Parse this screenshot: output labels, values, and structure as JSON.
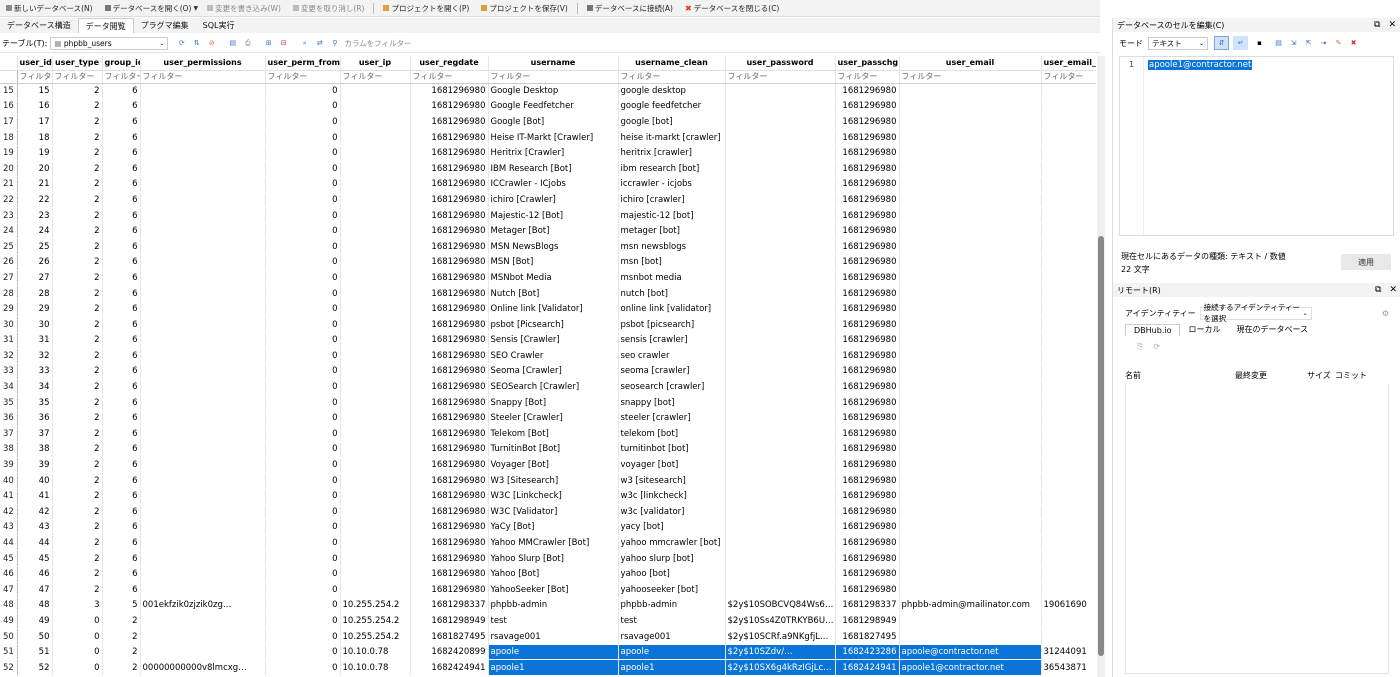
{
  "toolbar": {
    "new_db": "新しいデータベース(N)",
    "open_db": "データベースを開く(O)",
    "write_changes": "変更を書き込み(W)",
    "revert_changes": "変更を取り消し(R)",
    "open_project": "プロジェクトを開く(P)",
    "save_project": "プロジェクトを保存(V)",
    "attach_db": "データベースに接続(A)",
    "close_db": "データベースを閉じる(C)"
  },
  "tabs": [
    "データベース構造",
    "データ閲覧",
    "プラグマ編集",
    "SQL実行"
  ],
  "active_tab": 1,
  "filterbar": {
    "table_label": "テーブル(T):",
    "table_value": "phpbb_users",
    "column_filter_placeholder": "カラムをフィルター"
  },
  "grid": {
    "columns": [
      "user_id",
      "user_type",
      "group_id",
      "user_permissions",
      "user_perm_from",
      "user_ip",
      "user_regdate",
      "username",
      "username_clean",
      "user_password",
      "user_passchg",
      "user_email",
      "user_email_h"
    ],
    "filter_placeholder": "フィルター",
    "rows": [
      [
        "15",
        "15",
        "2",
        "6",
        "",
        "0",
        "",
        "1681296980",
        "Google Desktop",
        "google desktop",
        "",
        "1681296980",
        "",
        ""
      ],
      [
        "16",
        "16",
        "2",
        "6",
        "",
        "0",
        "",
        "1681296980",
        "Google Feedfetcher",
        "google feedfetcher",
        "",
        "1681296980",
        "",
        ""
      ],
      [
        "17",
        "17",
        "2",
        "6",
        "",
        "0",
        "",
        "1681296980",
        "Google [Bot]",
        "google [bot]",
        "",
        "1681296980",
        "",
        ""
      ],
      [
        "18",
        "18",
        "2",
        "6",
        "",
        "0",
        "",
        "1681296980",
        "Heise IT-Markt [Crawler]",
        "heise it-markt [crawler]",
        "",
        "1681296980",
        "",
        ""
      ],
      [
        "19",
        "19",
        "2",
        "6",
        "",
        "0",
        "",
        "1681296980",
        "Heritrix [Crawler]",
        "heritrix [crawler]",
        "",
        "1681296980",
        "",
        ""
      ],
      [
        "20",
        "20",
        "2",
        "6",
        "",
        "0",
        "",
        "1681296980",
        "IBM Research [Bot]",
        "ibm research [bot]",
        "",
        "1681296980",
        "",
        ""
      ],
      [
        "21",
        "21",
        "2",
        "6",
        "",
        "0",
        "",
        "1681296980",
        "ICCrawler - ICjobs",
        "iccrawler - icjobs",
        "",
        "1681296980",
        "",
        ""
      ],
      [
        "22",
        "22",
        "2",
        "6",
        "",
        "0",
        "",
        "1681296980",
        "ichiro [Crawler]",
        "ichiro [crawler]",
        "",
        "1681296980",
        "",
        ""
      ],
      [
        "23",
        "23",
        "2",
        "6",
        "",
        "0",
        "",
        "1681296980",
        "Majestic-12 [Bot]",
        "majestic-12 [bot]",
        "",
        "1681296980",
        "",
        ""
      ],
      [
        "24",
        "24",
        "2",
        "6",
        "",
        "0",
        "",
        "1681296980",
        "Metager [Bot]",
        "metager [bot]",
        "",
        "1681296980",
        "",
        ""
      ],
      [
        "25",
        "25",
        "2",
        "6",
        "",
        "0",
        "",
        "1681296980",
        "MSN NewsBlogs",
        "msn newsblogs",
        "",
        "1681296980",
        "",
        ""
      ],
      [
        "26",
        "26",
        "2",
        "6",
        "",
        "0",
        "",
        "1681296980",
        "MSN [Bot]",
        "msn [bot]",
        "",
        "1681296980",
        "",
        ""
      ],
      [
        "27",
        "27",
        "2",
        "6",
        "",
        "0",
        "",
        "1681296980",
        "MSNbot Media",
        "msnbot media",
        "",
        "1681296980",
        "",
        ""
      ],
      [
        "28",
        "28",
        "2",
        "6",
        "",
        "0",
        "",
        "1681296980",
        "Nutch [Bot]",
        "nutch [bot]",
        "",
        "1681296980",
        "",
        ""
      ],
      [
        "29",
        "29",
        "2",
        "6",
        "",
        "0",
        "",
        "1681296980",
        "Online link [Validator]",
        "online link [validator]",
        "",
        "1681296980",
        "",
        ""
      ],
      [
        "30",
        "30",
        "2",
        "6",
        "",
        "0",
        "",
        "1681296980",
        "psbot [Picsearch]",
        "psbot [picsearch]",
        "",
        "1681296980",
        "",
        ""
      ],
      [
        "31",
        "31",
        "2",
        "6",
        "",
        "0",
        "",
        "1681296980",
        "Sensis [Crawler]",
        "sensis [crawler]",
        "",
        "1681296980",
        "",
        ""
      ],
      [
        "32",
        "32",
        "2",
        "6",
        "",
        "0",
        "",
        "1681296980",
        "SEO Crawler",
        "seo crawler",
        "",
        "1681296980",
        "",
        ""
      ],
      [
        "33",
        "33",
        "2",
        "6",
        "",
        "0",
        "",
        "1681296980",
        "Seoma [Crawler]",
        "seoma [crawler]",
        "",
        "1681296980",
        "",
        ""
      ],
      [
        "34",
        "34",
        "2",
        "6",
        "",
        "0",
        "",
        "1681296980",
        "SEOSearch [Crawler]",
        "seosearch [crawler]",
        "",
        "1681296980",
        "",
        ""
      ],
      [
        "35",
        "35",
        "2",
        "6",
        "",
        "0",
        "",
        "1681296980",
        "Snappy [Bot]",
        "snappy [bot]",
        "",
        "1681296980",
        "",
        ""
      ],
      [
        "36",
        "36",
        "2",
        "6",
        "",
        "0",
        "",
        "1681296980",
        "Steeler [Crawler]",
        "steeler [crawler]",
        "",
        "1681296980",
        "",
        ""
      ],
      [
        "37",
        "37",
        "2",
        "6",
        "",
        "0",
        "",
        "1681296980",
        "Telekom [Bot]",
        "telekom [bot]",
        "",
        "1681296980",
        "",
        ""
      ],
      [
        "38",
        "38",
        "2",
        "6",
        "",
        "0",
        "",
        "1681296980",
        "TurnitinBot [Bot]",
        "turnitinbot [bot]",
        "",
        "1681296980",
        "",
        ""
      ],
      [
        "39",
        "39",
        "2",
        "6",
        "",
        "0",
        "",
        "1681296980",
        "Voyager [Bot]",
        "voyager [bot]",
        "",
        "1681296980",
        "",
        ""
      ],
      [
        "40",
        "40",
        "2",
        "6",
        "",
        "0",
        "",
        "1681296980",
        "W3 [Sitesearch]",
        "w3 [sitesearch]",
        "",
        "1681296980",
        "",
        ""
      ],
      [
        "41",
        "41",
        "2",
        "6",
        "",
        "0",
        "",
        "1681296980",
        "W3C [Linkcheck]",
        "w3c [linkcheck]",
        "",
        "1681296980",
        "",
        ""
      ],
      [
        "42",
        "42",
        "2",
        "6",
        "",
        "0",
        "",
        "1681296980",
        "W3C [Validator]",
        "w3c [validator]",
        "",
        "1681296980",
        "",
        ""
      ],
      [
        "43",
        "43",
        "2",
        "6",
        "",
        "0",
        "",
        "1681296980",
        "YaCy [Bot]",
        "yacy [bot]",
        "",
        "1681296980",
        "",
        ""
      ],
      [
        "44",
        "44",
        "2",
        "6",
        "",
        "0",
        "",
        "1681296980",
        "Yahoo MMCrawler [Bot]",
        "yahoo mmcrawler [bot]",
        "",
        "1681296980",
        "",
        ""
      ],
      [
        "45",
        "45",
        "2",
        "6",
        "",
        "0",
        "",
        "1681296980",
        "Yahoo Slurp [Bot]",
        "yahoo slurp [bot]",
        "",
        "1681296980",
        "",
        ""
      ],
      [
        "46",
        "46",
        "2",
        "6",
        "",
        "0",
        "",
        "1681296980",
        "Yahoo [Bot]",
        "yahoo [bot]",
        "",
        "1681296980",
        "",
        ""
      ],
      [
        "47",
        "47",
        "2",
        "6",
        "",
        "0",
        "",
        "1681296980",
        "YahooSeeker [Bot]",
        "yahooseeker [bot]",
        "",
        "1681296980",
        "",
        ""
      ],
      [
        "48",
        "48",
        "3",
        "5",
        "001ekfzik0zjzik0zg…",
        "0",
        "10.255.254.2",
        "1681298337",
        "phpbb-admin",
        "phpbb-admin",
        "$2y$10SOBCVQ84Ws6…",
        "1681298337",
        "phpbb-admin@mailinator.com",
        "19061690"
      ],
      [
        "49",
        "49",
        "0",
        "2",
        "",
        "0",
        "10.255.254.2",
        "1681298949",
        "test",
        "test",
        "$2y$10Ss4Z0TRKYB6U…",
        "1681298949",
        "",
        ""
      ],
      [
        "50",
        "50",
        "0",
        "2",
        "",
        "0",
        "10.255.254.2",
        "1681827495",
        "rsavage001",
        "rsavage001",
        "$2y$10SCRf.a9NKgfjL…",
        "1681827495",
        "",
        ""
      ],
      [
        "51",
        "51",
        "0",
        "2",
        "",
        "0",
        "10.10.0.78",
        "1682420899",
        "apoole",
        "apoole",
        "$2y$10SZdv/…",
        "1682423286",
        "apoole@contractor.net",
        "31244091"
      ],
      [
        "52",
        "52",
        "0",
        "2",
        "00000000000v8lmcxg…",
        "0",
        "10.10.0.78",
        "1682424941",
        "apoole1",
        "apoole1",
        "$2y$10SX6g4kRzIGjLc…",
        "1682424941",
        "apoole1@contractor.net",
        "36543871"
      ]
    ]
  },
  "edit_panel": {
    "title": "データベースのセルを編集(C)",
    "mode_label": "モード",
    "mode_value": "テキスト",
    "line_number": "1",
    "cell_value": "apoole1@contractor.net",
    "type_info": "現在セルにあるデータの種類: テキスト / 数値",
    "length_info": "22 文字",
    "apply_label": "適用"
  },
  "remote_panel": {
    "title": "リモート(R)",
    "identity_label": "アイデンティティー",
    "identity_value": "接続するアイデンティティーを選択",
    "tabs": [
      "DBHub.io",
      "ローカル",
      "現在のデータベース"
    ],
    "columns": [
      "名前",
      "最終変更",
      "サイズ",
      "コミット"
    ]
  },
  "colors": {
    "selection": "#0a74d8",
    "panel_bg": "#f3f3f3"
  }
}
